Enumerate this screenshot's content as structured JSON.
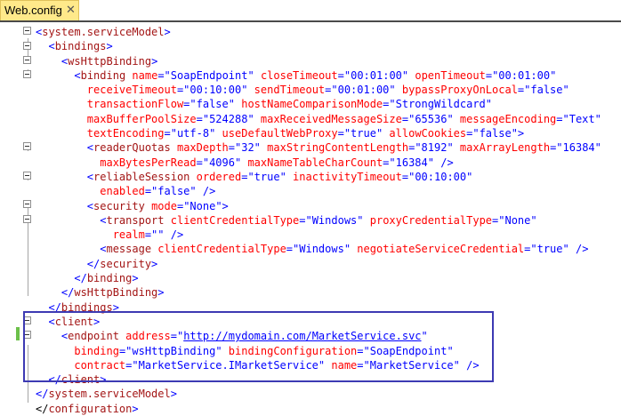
{
  "tab": {
    "title": "Web.config",
    "close": "✕"
  },
  "lines": [
    [
      [
        "p",
        "<"
      ],
      [
        "t",
        "system.serviceModel"
      ],
      [
        "p",
        ">"
      ]
    ],
    [
      [
        "x",
        "  "
      ],
      [
        "p",
        "<"
      ],
      [
        "t",
        "bindings"
      ],
      [
        "p",
        ">"
      ]
    ],
    [
      [
        "x",
        "    "
      ],
      [
        "p",
        "<"
      ],
      [
        "t",
        "wsHttpBinding"
      ],
      [
        "p",
        ">"
      ]
    ],
    [
      [
        "x",
        "      "
      ],
      [
        "p",
        "<"
      ],
      [
        "t",
        "binding"
      ],
      [
        "x",
        " "
      ],
      [
        "a",
        "name"
      ],
      [
        "p",
        "=\""
      ],
      [
        "v",
        "SoapEndpoint"
      ],
      [
        "p",
        "\""
      ],
      [
        "x",
        " "
      ],
      [
        "a",
        "closeTimeout"
      ],
      [
        "p",
        "=\""
      ],
      [
        "v",
        "00:01:00"
      ],
      [
        "p",
        "\""
      ],
      [
        "x",
        " "
      ],
      [
        "a",
        "openTimeout"
      ],
      [
        "p",
        "=\""
      ],
      [
        "v",
        "00:01:00"
      ],
      [
        "p",
        "\""
      ]
    ],
    [
      [
        "x",
        "        "
      ],
      [
        "a",
        "receiveTimeout"
      ],
      [
        "p",
        "=\""
      ],
      [
        "v",
        "00:10:00"
      ],
      [
        "p",
        "\""
      ],
      [
        "x",
        " "
      ],
      [
        "a",
        "sendTimeout"
      ],
      [
        "p",
        "=\""
      ],
      [
        "v",
        "00:01:00"
      ],
      [
        "p",
        "\""
      ],
      [
        "x",
        " "
      ],
      [
        "a",
        "bypassProxyOnLocal"
      ],
      [
        "p",
        "=\""
      ],
      [
        "v",
        "false"
      ],
      [
        "p",
        "\""
      ]
    ],
    [
      [
        "x",
        "        "
      ],
      [
        "a",
        "transactionFlow"
      ],
      [
        "p",
        "=\""
      ],
      [
        "v",
        "false"
      ],
      [
        "p",
        "\""
      ],
      [
        "x",
        " "
      ],
      [
        "a",
        "hostNameComparisonMode"
      ],
      [
        "p",
        "=\""
      ],
      [
        "v",
        "StrongWildcard"
      ],
      [
        "p",
        "\""
      ]
    ],
    [
      [
        "x",
        "        "
      ],
      [
        "a",
        "maxBufferPoolSize"
      ],
      [
        "p",
        "=\""
      ],
      [
        "v",
        "524288"
      ],
      [
        "p",
        "\""
      ],
      [
        "x",
        " "
      ],
      [
        "a",
        "maxReceivedMessageSize"
      ],
      [
        "p",
        "=\""
      ],
      [
        "v",
        "65536"
      ],
      [
        "p",
        "\""
      ],
      [
        "x",
        " "
      ],
      [
        "a",
        "messageEncoding"
      ],
      [
        "p",
        "=\""
      ],
      [
        "v",
        "Text"
      ],
      [
        "p",
        "\""
      ]
    ],
    [
      [
        "x",
        "        "
      ],
      [
        "a",
        "textEncoding"
      ],
      [
        "p",
        "=\""
      ],
      [
        "v",
        "utf-8"
      ],
      [
        "p",
        "\""
      ],
      [
        "x",
        " "
      ],
      [
        "a",
        "useDefaultWebProxy"
      ],
      [
        "p",
        "=\""
      ],
      [
        "v",
        "true"
      ],
      [
        "p",
        "\""
      ],
      [
        "x",
        " "
      ],
      [
        "a",
        "allowCookies"
      ],
      [
        "p",
        "=\""
      ],
      [
        "v",
        "false"
      ],
      [
        "p",
        "\">"
      ]
    ],
    [
      [
        "x",
        "        "
      ],
      [
        "p",
        "<"
      ],
      [
        "t",
        "readerQuotas"
      ],
      [
        "x",
        " "
      ],
      [
        "a",
        "maxDepth"
      ],
      [
        "p",
        "=\""
      ],
      [
        "v",
        "32"
      ],
      [
        "p",
        "\""
      ],
      [
        "x",
        " "
      ],
      [
        "a",
        "maxStringContentLength"
      ],
      [
        "p",
        "=\""
      ],
      [
        "v",
        "8192"
      ],
      [
        "p",
        "\""
      ],
      [
        "x",
        " "
      ],
      [
        "a",
        "maxArrayLength"
      ],
      [
        "p",
        "=\""
      ],
      [
        "v",
        "16384"
      ],
      [
        "p",
        "\""
      ]
    ],
    [
      [
        "x",
        "          "
      ],
      [
        "a",
        "maxBytesPerRead"
      ],
      [
        "p",
        "=\""
      ],
      [
        "v",
        "4096"
      ],
      [
        "p",
        "\""
      ],
      [
        "x",
        " "
      ],
      [
        "a",
        "maxNameTableCharCount"
      ],
      [
        "p",
        "=\""
      ],
      [
        "v",
        "16384"
      ],
      [
        "p",
        "\""
      ],
      [
        "x",
        " "
      ],
      [
        "p",
        "/>"
      ]
    ],
    [
      [
        "x",
        "        "
      ],
      [
        "p",
        "<"
      ],
      [
        "t",
        "reliableSession"
      ],
      [
        "x",
        " "
      ],
      [
        "a",
        "ordered"
      ],
      [
        "p",
        "=\""
      ],
      [
        "v",
        "true"
      ],
      [
        "p",
        "\""
      ],
      [
        "x",
        " "
      ],
      [
        "a",
        "inactivityTimeout"
      ],
      [
        "p",
        "=\""
      ],
      [
        "v",
        "00:10:00"
      ],
      [
        "p",
        "\""
      ]
    ],
    [
      [
        "x",
        "          "
      ],
      [
        "a",
        "enabled"
      ],
      [
        "p",
        "=\""
      ],
      [
        "v",
        "false"
      ],
      [
        "p",
        "\""
      ],
      [
        "x",
        " "
      ],
      [
        "p",
        "/>"
      ]
    ],
    [
      [
        "x",
        "        "
      ],
      [
        "p",
        "<"
      ],
      [
        "t",
        "security"
      ],
      [
        "x",
        " "
      ],
      [
        "a",
        "mode"
      ],
      [
        "p",
        "=\""
      ],
      [
        "v",
        "None"
      ],
      [
        "p",
        "\">"
      ]
    ],
    [
      [
        "x",
        "          "
      ],
      [
        "p",
        "<"
      ],
      [
        "t",
        "transport"
      ],
      [
        "x",
        " "
      ],
      [
        "a",
        "clientCredentialType"
      ],
      [
        "p",
        "=\""
      ],
      [
        "v",
        "Windows"
      ],
      [
        "p",
        "\""
      ],
      [
        "x",
        " "
      ],
      [
        "a",
        "proxyCredentialType"
      ],
      [
        "p",
        "=\""
      ],
      [
        "v",
        "None"
      ],
      [
        "p",
        "\""
      ]
    ],
    [
      [
        "x",
        "            "
      ],
      [
        "a",
        "realm"
      ],
      [
        "p",
        "=\"\""
      ],
      [
        "x",
        " "
      ],
      [
        "p",
        "/>"
      ]
    ],
    [
      [
        "x",
        "          "
      ],
      [
        "p",
        "<"
      ],
      [
        "t",
        "message"
      ],
      [
        "x",
        " "
      ],
      [
        "a",
        "clientCredentialType"
      ],
      [
        "p",
        "=\""
      ],
      [
        "v",
        "Windows"
      ],
      [
        "p",
        "\""
      ],
      [
        "x",
        " "
      ],
      [
        "a",
        "negotiateServiceCredential"
      ],
      [
        "p",
        "=\""
      ],
      [
        "v",
        "true"
      ],
      [
        "p",
        "\""
      ],
      [
        "x",
        " "
      ],
      [
        "p",
        "/>"
      ]
    ],
    [
      [
        "x",
        "        "
      ],
      [
        "p",
        "</"
      ],
      [
        "t",
        "security"
      ],
      [
        "p",
        ">"
      ]
    ],
    [
      [
        "x",
        "      "
      ],
      [
        "p",
        "</"
      ],
      [
        "t",
        "binding"
      ],
      [
        "p",
        ">"
      ]
    ],
    [
      [
        "x",
        "    "
      ],
      [
        "p",
        "</"
      ],
      [
        "t",
        "wsHttpBinding"
      ],
      [
        "p",
        ">"
      ]
    ],
    [
      [
        "x",
        "  "
      ],
      [
        "p",
        "</"
      ],
      [
        "t",
        "bindings"
      ],
      [
        "p",
        ">"
      ]
    ],
    [
      [
        "x",
        "  "
      ],
      [
        "p",
        "<"
      ],
      [
        "t",
        "client"
      ],
      [
        "p",
        ">"
      ]
    ],
    [
      [
        "x",
        "    "
      ],
      [
        "p",
        "<"
      ],
      [
        "t",
        "endpoint"
      ],
      [
        "x",
        " "
      ],
      [
        "a",
        "address"
      ],
      [
        "p",
        "=\""
      ],
      [
        "u",
        "http://mydomain.com/MarketService.svc"
      ],
      [
        "p",
        "\""
      ]
    ],
    [
      [
        "x",
        "      "
      ],
      [
        "a",
        "binding"
      ],
      [
        "p",
        "=\""
      ],
      [
        "v",
        "wsHttpBinding"
      ],
      [
        "p",
        "\""
      ],
      [
        "x",
        " "
      ],
      [
        "a",
        "bindingConfiguration"
      ],
      [
        "p",
        "=\""
      ],
      [
        "v",
        "SoapEndpoint"
      ],
      [
        "p",
        "\""
      ]
    ],
    [
      [
        "x",
        "      "
      ],
      [
        "a",
        "contract"
      ],
      [
        "p",
        "=\""
      ],
      [
        "v",
        "MarketService.IMarketService"
      ],
      [
        "p",
        "\""
      ],
      [
        "x",
        " "
      ],
      [
        "a",
        "name"
      ],
      [
        "p",
        "=\""
      ],
      [
        "v",
        "MarketService"
      ],
      [
        "p",
        "\""
      ],
      [
        "x",
        " "
      ],
      [
        "p",
        "/>"
      ]
    ],
    [
      [
        "x",
        "  "
      ],
      [
        "p",
        "</"
      ],
      [
        "t",
        "client"
      ],
      [
        "p",
        ">"
      ]
    ],
    [
      [
        "p",
        "</"
      ],
      [
        "t",
        "system.serviceModel"
      ],
      [
        "p",
        ">"
      ]
    ],
    [
      [
        "x",
        "</"
      ],
      [
        "t",
        "configuration"
      ],
      [
        "p",
        ">"
      ]
    ]
  ],
  "colors": {
    "tag": "#a31515",
    "punct": "#0000ff",
    "attr": "#ff0000",
    "value": "#0000ff",
    "highlight": "#3d3ab3",
    "tab": "#ffe98a"
  }
}
